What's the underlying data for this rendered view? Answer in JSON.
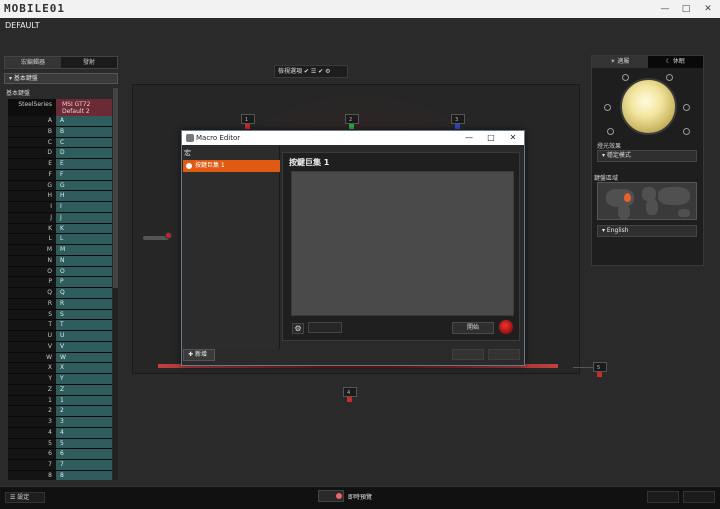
{
  "app": {
    "logo": "MOBILE01",
    "profile": "DEFAULT"
  },
  "window": {
    "minimize": "—",
    "maximize": "□",
    "close": "✕"
  },
  "left": {
    "tabs": [
      "宏編輯器",
      "發射"
    ],
    "section": "基本鍵盤",
    "sublabel": "基本鍵盤",
    "col1": "SteelSeries",
    "col2": "MSI GT72 Default 2",
    "keys": [
      "A",
      "B",
      "C",
      "D",
      "E",
      "F",
      "G",
      "H",
      "I",
      "J",
      "K",
      "L",
      "M",
      "N",
      "O",
      "P",
      "Q",
      "R",
      "S",
      "T",
      "U",
      "V",
      "W",
      "X",
      "Y",
      "Z",
      "1",
      "2",
      "3",
      "4",
      "5",
      "6",
      "7",
      "8"
    ]
  },
  "center": {
    "toolbar_label": "檢視選項",
    "pins": [
      {
        "label": "1",
        "color": "#c92a2a"
      },
      {
        "label": "2",
        "color": "#2aa84a"
      },
      {
        "label": "3",
        "color": "#2a4ac9"
      },
      {
        "label": "4",
        "color": "#c92a2a"
      },
      {
        "label": "5",
        "color": "#c92a2a"
      }
    ]
  },
  "right": {
    "tab_active": "適屬",
    "tab_inactive": "休眠",
    "light_label": "燈光效果",
    "light_value": "穩定模式",
    "region_label": "鍵盤區域",
    "language": "English"
  },
  "bottom": {
    "settings": "設定",
    "live_label": "即時預覽"
  },
  "dialog": {
    "title": "Macro Editor",
    "list_header": "宏",
    "item": "按鍵巨集 1",
    "new_button": "新增",
    "main_title": "按鍵巨集 1",
    "start_button": "開始",
    "footer_buttons": [
      "",
      ""
    ]
  }
}
